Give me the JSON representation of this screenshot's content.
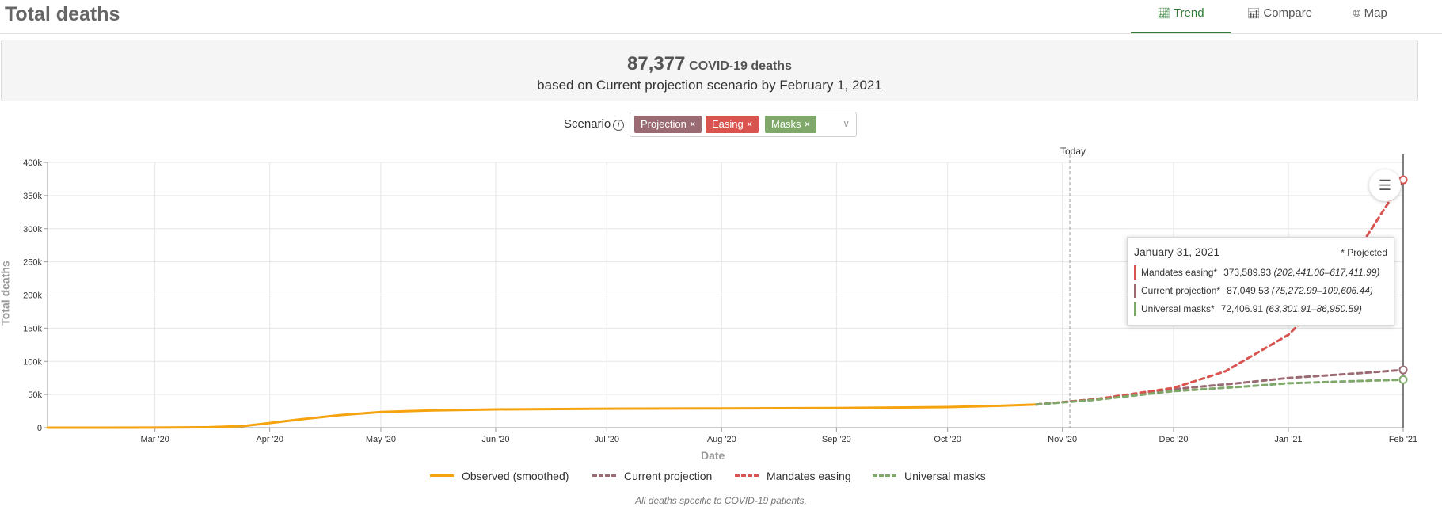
{
  "header": {
    "title": "Total deaths",
    "tabs": [
      {
        "label": "Trend",
        "icon": "line-chart-icon",
        "active": true
      },
      {
        "label": "Compare",
        "icon": "area-chart-icon",
        "active": false
      },
      {
        "label": "Map",
        "icon": "globe-icon",
        "active": false
      }
    ]
  },
  "summary": {
    "count": "87,377",
    "count_suffix": "COVID-19 deaths",
    "subtitle": "based on Current projection scenario by February 1, 2021"
  },
  "scenario": {
    "label": "Scenario",
    "chips": [
      {
        "label": "Projection",
        "color": "#9a6b72"
      },
      {
        "label": "Easing",
        "color": "#d9534f"
      },
      {
        "label": "Masks",
        "color": "#7fa86a"
      }
    ]
  },
  "chart": {
    "today_label": "Today",
    "settings_icon": "sliders-icon"
  },
  "tooltip": {
    "date": "January 31, 2021",
    "projected_note": "* Projected",
    "rows": [
      {
        "label": "Mandates easing*",
        "value": "373,589.93",
        "range": "(202,441.06–617,411.99)",
        "color": "#d9534f"
      },
      {
        "label": "Current projection*",
        "value": "87,049.53",
        "range": "(75,272.99–109,606.44)",
        "color": "#9a6b72"
      },
      {
        "label": "Universal masks*",
        "value": "72,406.91",
        "range": "(63,301.91–86,950.59)",
        "color": "#7fa86a"
      }
    ]
  },
  "legend": [
    {
      "label": "Observed (smoothed)",
      "color": "#f5a40f",
      "dashed": false
    },
    {
      "label": "Current projection",
      "color": "#9a6b72",
      "dashed": true
    },
    {
      "label": "Mandates easing",
      "color": "#d9534f",
      "dashed": true
    },
    {
      "label": "Universal masks",
      "color": "#7fa86a",
      "dashed": true
    }
  ],
  "footnote": "All deaths specific to COVID-19 patients.",
  "chart_data": {
    "type": "line",
    "xlabel": "Date",
    "ylabel": "Total deaths",
    "x_start": "2020-02-01",
    "x_end": "2021-02-01",
    "today": "2020-11-03",
    "y_ticks": [
      "0",
      "50k",
      "100k",
      "150k",
      "200k",
      "250k",
      "300k",
      "350k",
      "400k"
    ],
    "ylim": [
      0,
      400000
    ],
    "x_ticks": [
      {
        "date": "2020-03-01",
        "label": "Mar '20"
      },
      {
        "date": "2020-04-01",
        "label": "Apr '20"
      },
      {
        "date": "2020-05-01",
        "label": "May '20"
      },
      {
        "date": "2020-06-01",
        "label": "Jun '20"
      },
      {
        "date": "2020-07-01",
        "label": "Jul '20"
      },
      {
        "date": "2020-08-01",
        "label": "Aug '20"
      },
      {
        "date": "2020-09-01",
        "label": "Sep '20"
      },
      {
        "date": "2020-10-01",
        "label": "Oct '20"
      },
      {
        "date": "2020-11-01",
        "label": "Nov '20"
      },
      {
        "date": "2020-12-01",
        "label": "Dec '20"
      },
      {
        "date": "2021-01-01",
        "label": "Jan '21"
      },
      {
        "date": "2021-02-01",
        "label": "Feb '21"
      }
    ],
    "grid": true,
    "series": [
      {
        "name": "Observed (smoothed)",
        "color": "#f5a40f",
        "dashed": false,
        "points": [
          [
            "2020-02-01",
            0
          ],
          [
            "2020-03-01",
            100
          ],
          [
            "2020-03-15",
            600
          ],
          [
            "2020-03-25",
            2500
          ],
          [
            "2020-04-01",
            7000
          ],
          [
            "2020-04-10",
            13000
          ],
          [
            "2020-04-20",
            19000
          ],
          [
            "2020-05-01",
            23500
          ],
          [
            "2020-05-15",
            26000
          ],
          [
            "2020-06-01",
            27500
          ],
          [
            "2020-07-01",
            28500
          ],
          [
            "2020-08-01",
            29000
          ],
          [
            "2020-09-01",
            29500
          ],
          [
            "2020-10-01",
            31000
          ],
          [
            "2020-10-15",
            33000
          ],
          [
            "2020-10-25",
            35000
          ]
        ]
      },
      {
        "name": "Current projection",
        "color": "#9a6b72",
        "dashed": true,
        "points": [
          [
            "2020-10-25",
            35000
          ],
          [
            "2020-11-10",
            43000
          ],
          [
            "2020-12-01",
            58000
          ],
          [
            "2020-12-20",
            68000
          ],
          [
            "2021-01-01",
            75000
          ],
          [
            "2021-01-20",
            82000
          ],
          [
            "2021-02-01",
            87049.53
          ]
        ]
      },
      {
        "name": "Mandates easing",
        "color": "#d9534f",
        "dashed": true,
        "points": [
          [
            "2020-10-25",
            35000
          ],
          [
            "2020-11-10",
            43000
          ],
          [
            "2020-12-01",
            60000
          ],
          [
            "2020-12-15",
            85000
          ],
          [
            "2021-01-01",
            140000
          ],
          [
            "2021-01-10",
            190000
          ],
          [
            "2021-01-20",
            270000
          ],
          [
            "2021-02-01",
            373589.93
          ]
        ]
      },
      {
        "name": "Universal masks",
        "color": "#7fa86a",
        "dashed": true,
        "points": [
          [
            "2020-10-25",
            35000
          ],
          [
            "2020-11-10",
            42000
          ],
          [
            "2020-12-01",
            55000
          ],
          [
            "2020-12-20",
            62000
          ],
          [
            "2021-01-01",
            67000
          ],
          [
            "2021-01-20",
            70500
          ],
          [
            "2021-02-01",
            72406.91
          ]
        ]
      }
    ]
  }
}
